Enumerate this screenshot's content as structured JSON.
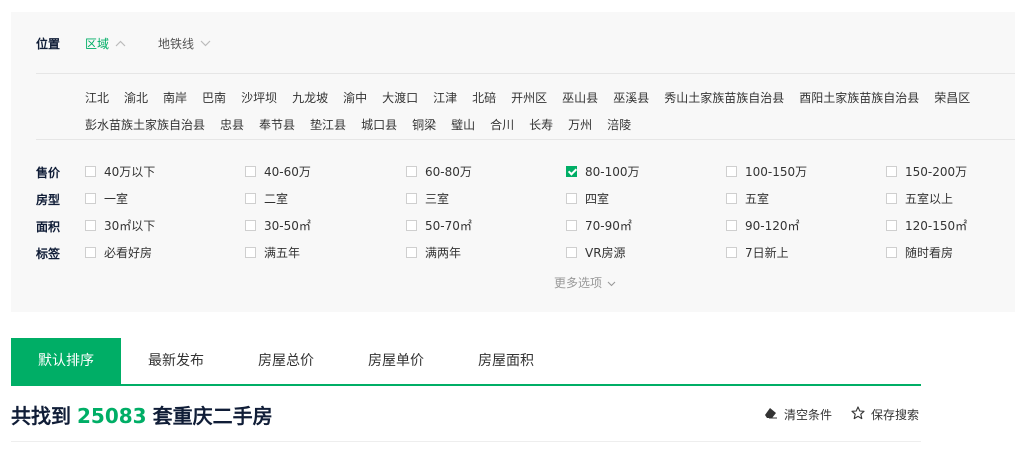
{
  "location": {
    "label": "位置",
    "tabs": [
      {
        "label": "区域",
        "active": true
      },
      {
        "label": "地铁线",
        "active": false
      }
    ],
    "districts_row1": [
      "江北",
      "渝北",
      "南岸",
      "巴南",
      "沙坪坝",
      "九龙坡",
      "渝中",
      "大渡口",
      "江津",
      "北碚",
      "开州区",
      "巫山县",
      "巫溪县",
      "秀山土家族苗族自治县",
      "酉阳土家族苗族自治县",
      "荣昌区"
    ],
    "districts_row2": [
      "彭水苗族土家族自治县",
      "忠县",
      "奉节县",
      "垫江县",
      "城口县",
      "铜梁",
      "璧山",
      "合川",
      "长寿",
      "万州",
      "涪陵"
    ]
  },
  "filters": {
    "price": {
      "label": "售价",
      "options": [
        {
          "label": "40万以下",
          "checked": false
        },
        {
          "label": "40-60万",
          "checked": false
        },
        {
          "label": "60-80万",
          "checked": false
        },
        {
          "label": "80-100万",
          "checked": true
        },
        {
          "label": "100-150万",
          "checked": false
        },
        {
          "label": "150-200万",
          "checked": false
        }
      ]
    },
    "layout": {
      "label": "房型",
      "options": [
        {
          "label": "一室",
          "checked": false
        },
        {
          "label": "二室",
          "checked": false
        },
        {
          "label": "三室",
          "checked": false
        },
        {
          "label": "四室",
          "checked": false
        },
        {
          "label": "五室",
          "checked": false
        },
        {
          "label": "五室以上",
          "checked": false
        }
      ]
    },
    "area": {
      "label": "面积",
      "options": [
        {
          "label": "30㎡以下",
          "checked": false
        },
        {
          "label": "30-50㎡",
          "checked": false
        },
        {
          "label": "50-70㎡",
          "checked": false
        },
        {
          "label": "70-90㎡",
          "checked": false
        },
        {
          "label": "90-120㎡",
          "checked": false
        },
        {
          "label": "120-150㎡",
          "checked": false
        }
      ]
    },
    "tags": {
      "label": "标签",
      "options": [
        {
          "label": "必看好房",
          "checked": false
        },
        {
          "label": "满五年",
          "checked": false
        },
        {
          "label": "满两年",
          "checked": false
        },
        {
          "label": "VR房源",
          "checked": false
        },
        {
          "label": "7日新上",
          "checked": false
        },
        {
          "label": "随时看房",
          "checked": false
        }
      ]
    },
    "more_label": "更多选项"
  },
  "sort": {
    "tabs": [
      {
        "label": "默认排序",
        "active": true
      },
      {
        "label": "最新发布",
        "active": false
      },
      {
        "label": "房屋总价",
        "active": false
      },
      {
        "label": "房屋单价",
        "active": false
      },
      {
        "label": "房屋面积",
        "active": false
      }
    ]
  },
  "result": {
    "prefix": "共找到",
    "count": "25083",
    "suffix": "套重庆二手房"
  },
  "tools": {
    "clear_label": "清空条件",
    "save_label": "保存搜索"
  },
  "colors": {
    "accent": "#00ae66",
    "panel_bg": "#f8f8f8",
    "heading": "#101d37"
  },
  "icons": {
    "clear": "eraser-icon",
    "save": "star-outline-icon",
    "chevron_up": "chevron-up-icon",
    "chevron_down": "chevron-down-icon"
  }
}
